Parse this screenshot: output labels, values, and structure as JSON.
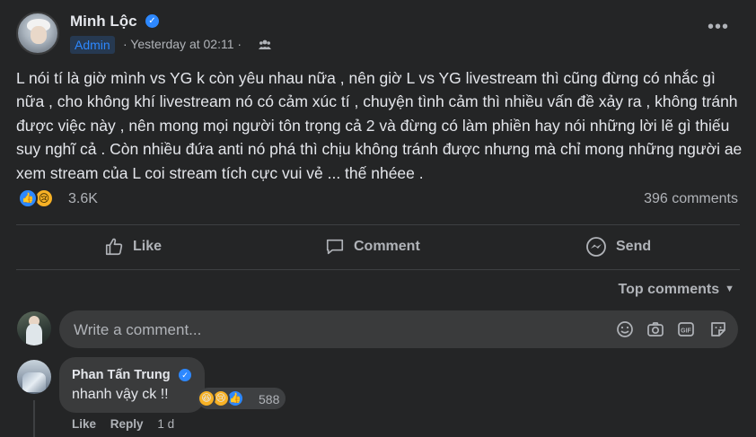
{
  "post": {
    "author": "Minh Lộc",
    "badge": "Admin",
    "time": "· Yesterday at 02:11 ·",
    "privacy_icon": "group-icon",
    "more": "•••",
    "text": "L nói tí là giờ mình vs YG k còn yêu nhau nữa , nên giờ L vs YG livestream thì cũng đừng có nhắc gì nữa , cho không khí livestream nó có cảm xúc tí , chuyện tình cảm thì nhiều vấn đề xảy ra , không tránh được việc này , nên mong mọi người tôn trọng cả 2 và đừng có làm phiền hay nói những lời lẽ gì thiếu suy nghĩ cả . Còn nhiều đứa anti nó phá thì chịu không tránh được nhưng mà chỉ mong những người ae xem stream của L coi stream tích cực vui vẻ ... thế nhéee .",
    "reaction_count": "3.6K",
    "comments_count": "396 comments"
  },
  "actions": {
    "like": "Like",
    "comment": "Comment",
    "send": "Send"
  },
  "top_comments": "Top comments",
  "write_comment": {
    "placeholder": "Write a comment..."
  },
  "comment": {
    "author": "Phan Tấn Trung",
    "text": "nhanh vậy ck !!",
    "reaction_count": "588",
    "like": "Like",
    "reply": "Reply",
    "time": "1 d"
  },
  "colors": {
    "background": "#242526",
    "accent": "#2d88ff",
    "text": "#e4e6eb",
    "secondary": "#b0b3b8"
  }
}
